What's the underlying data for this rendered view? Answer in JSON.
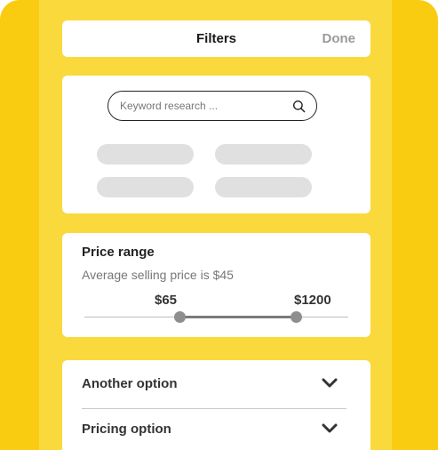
{
  "header": {
    "title": "Filters",
    "done_label": "Done"
  },
  "search": {
    "placeholder": "Keyword research ..."
  },
  "price": {
    "title": "Price range",
    "subtitle": "Average selling price is $45",
    "min_label": "$65",
    "max_label": "$1200"
  },
  "options": [
    {
      "label": "Another option",
      "icon": "chevron-down-icon"
    },
    {
      "label": "Pricing option",
      "icon": "chevron-down-icon"
    }
  ],
  "colors": {
    "device": "#F9CC12",
    "screen": "#FAD93D",
    "chip": "#E0E0E0",
    "done": "#9a9a9a",
    "slider": "#8e8e8e"
  }
}
